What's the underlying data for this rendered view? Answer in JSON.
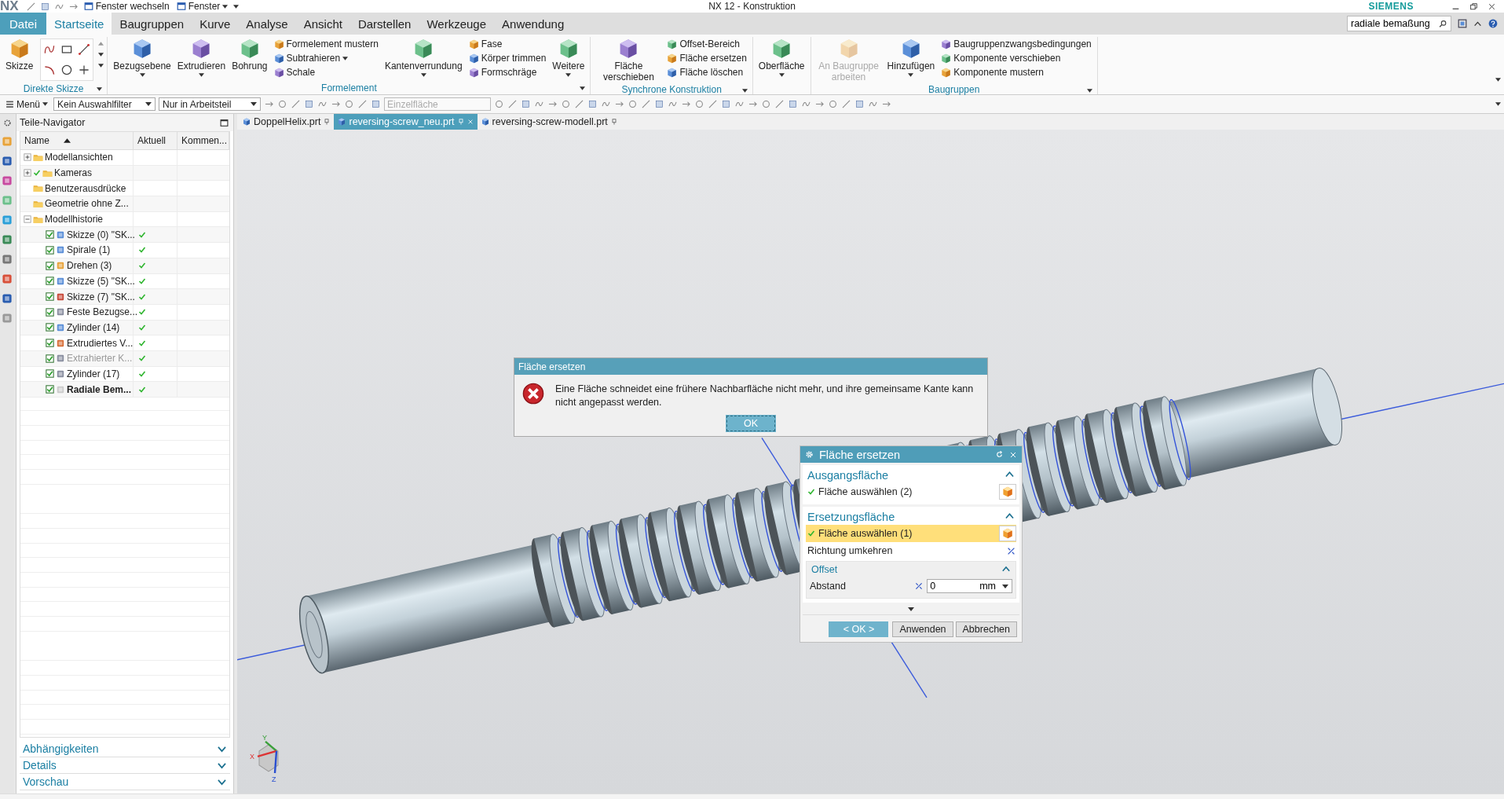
{
  "title_bar": {
    "logo": "NX",
    "quick_access": [
      {
        "label": "Fenster wechseln",
        "dropdown": false
      },
      {
        "label": "Fenster",
        "dropdown": true
      }
    ],
    "title": "NX 12 - Konstruktion",
    "brand": "SIEMENS"
  },
  "menu_tabs": [
    {
      "label": "Datei",
      "kind": "file",
      "selected": false
    },
    {
      "label": "Startseite",
      "kind": "tab",
      "selected": true
    },
    {
      "label": "Baugruppen",
      "kind": "tab",
      "selected": false
    },
    {
      "label": "Kurve",
      "kind": "tab",
      "selected": false
    },
    {
      "label": "Analyse",
      "kind": "tab",
      "selected": false
    },
    {
      "label": "Ansicht",
      "kind": "tab",
      "selected": false
    },
    {
      "label": "Darstellen",
      "kind": "tab",
      "selected": false
    },
    {
      "label": "Werkzeuge",
      "kind": "tab",
      "selected": false
    },
    {
      "label": "Anwendung",
      "kind": "tab",
      "selected": false
    }
  ],
  "search": {
    "value": "radiale bemaßung"
  },
  "ribbon": [
    {
      "title": "Direkte Skizze",
      "kind": "sketch",
      "launcher": true,
      "items": [
        {
          "label": "Skizze",
          "kind": "large",
          "dropdown": false,
          "disabled": false
        }
      ]
    },
    {
      "title": "Formelement",
      "kind": "tools",
      "launcher": true,
      "items": [
        {
          "label": "Bezugsebene",
          "kind": "large",
          "dropdown": true,
          "disabled": false
        },
        {
          "label": "Extrudieren",
          "kind": "large",
          "dropdown": true,
          "disabled": false
        },
        {
          "label": "Bohrung",
          "kind": "large",
          "dropdown": false,
          "disabled": false
        },
        {
          "label": "Formelement mustern",
          "kind": "small",
          "dropdown": false,
          "disabled": false
        },
        {
          "label": "Subtrahieren",
          "kind": "small",
          "dropdown": true,
          "disabled": false
        },
        {
          "label": "Schale",
          "kind": "small",
          "dropdown": false,
          "disabled": false
        },
        {
          "label": "Kantenverrundung",
          "kind": "large",
          "dropdown": true,
          "disabled": false
        },
        {
          "label": "Fase",
          "kind": "small",
          "dropdown": false,
          "disabled": false
        },
        {
          "label": "Körper trimmen",
          "kind": "small",
          "dropdown": false,
          "disabled": false
        },
        {
          "label": "Formschräge",
          "kind": "small",
          "dropdown": false,
          "disabled": false
        },
        {
          "label": "Weitere",
          "kind": "large",
          "dropdown": true,
          "disabled": false
        }
      ]
    },
    {
      "title": "Synchrone Konstruktion",
      "kind": "tools",
      "launcher": true,
      "items": [
        {
          "label": "Fläche verschieben",
          "kind": "large",
          "dropdown": false,
          "disabled": false
        },
        {
          "label": "Offset-Bereich",
          "kind": "small",
          "dropdown": false,
          "disabled": false
        },
        {
          "label": "Fläche ersetzen",
          "kind": "small",
          "dropdown": false,
          "disabled": false
        },
        {
          "label": "Fläche löschen",
          "kind": "small",
          "dropdown": false,
          "disabled": false
        }
      ]
    },
    {
      "kind": "tools",
      "launcher": false,
      "items": [
        {
          "label": "Oberfläche",
          "kind": "large",
          "dropdown": true,
          "disabled": false
        }
      ]
    },
    {
      "title": "Baugruppen",
      "kind": "tools",
      "launcher": true,
      "items": [
        {
          "label": "An Baugruppe arbeiten",
          "kind": "large",
          "dropdown": false,
          "disabled": true
        },
        {
          "label": "Hinzufügen",
          "kind": "large",
          "dropdown": true,
          "disabled": false
        },
        {
          "label": "Baugruppenzwangsbedingungen",
          "kind": "small",
          "dropdown": false,
          "disabled": false
        },
        {
          "label": "Komponente verschieben",
          "kind": "small",
          "dropdown": false,
          "disabled": false
        },
        {
          "label": "Komponente mustern",
          "kind": "small",
          "dropdown": false,
          "disabled": false
        }
      ]
    }
  ],
  "toolbar": {
    "menu": "Menü",
    "filters": [
      "Kein Auswahlfilter",
      "Nur in Arbeitsteil"
    ],
    "selection_field": {
      "placeholder": "Einzelfläche"
    }
  },
  "navigator": {
    "title": "Teile-Navigator",
    "columns": [
      "Name",
      "Aktuell",
      "Kommen..."
    ],
    "tree": [
      {
        "label": "Modellansichten",
        "expanded": false,
        "checked": false
      },
      {
        "label": "Kameras",
        "expanded": false,
        "checked": true
      },
      {
        "label": "Benutzerausdrücke",
        "checked": false
      },
      {
        "label": "Geometrie ohne Z...",
        "checked": false
      },
      {
        "label": "Modellhistorie",
        "expanded": true,
        "checked": false,
        "children": [
          {
            "label": "Skizze (0) \"SK...",
            "checked": true,
            "current": true,
            "dimmed": false,
            "active": false
          },
          {
            "label": "Spirale (1)",
            "checked": true,
            "current": true,
            "dimmed": false,
            "active": false
          },
          {
            "label": "Drehen (3)",
            "checked": true,
            "current": true,
            "dimmed": false,
            "active": false
          },
          {
            "label": "Skizze (5) \"SK...",
            "checked": true,
            "current": true,
            "dimmed": false,
            "active": false
          },
          {
            "label": "Skizze (7) \"SK...",
            "checked": true,
            "current": true,
            "dimmed": false,
            "active": false
          },
          {
            "label": "Feste Bezugse...",
            "checked": true,
            "current": true,
            "dimmed": false,
            "active": false
          },
          {
            "label": "Zylinder (14)",
            "checked": true,
            "current": true,
            "dimmed": false,
            "active": false
          },
          {
            "label": "Extrudiertes V...",
            "checked": true,
            "current": true,
            "dimmed": false,
            "active": false
          },
          {
            "label": "Extrahierter K...",
            "checked": true,
            "current": true,
            "dimmed": true,
            "active": false
          },
          {
            "label": "Zylinder (17)",
            "checked": true,
            "current": true,
            "dimmed": false,
            "active": false
          },
          {
            "label": "Radiale Bem...",
            "checked": true,
            "current": true,
            "dimmed": false,
            "active": true
          }
        ]
      }
    ],
    "panels": [
      {
        "label": "Abhängigkeiten",
        "expanded": false
      },
      {
        "label": "Details",
        "expanded": false
      },
      {
        "label": "Vorschau",
        "expanded": false
      }
    ]
  },
  "doc_tabs": [
    {
      "label": "DoppelHelix.prt",
      "selected": false
    },
    {
      "label": "reversing-screw_neu.prt",
      "selected": true
    },
    {
      "label": "reversing-screw-modell.prt",
      "selected": false
    }
  ],
  "viewport": {
    "triad": [
      "X",
      "Y",
      "Z"
    ]
  },
  "error_dialog": {
    "title": "Fläche ersetzen",
    "message": "Eine Fläche schneidet eine frühere Nachbarfläche nicht mehr, und ihre gemeinsame Kante kann nicht angepasst werden.",
    "button": "OK"
  },
  "replace_dialog": {
    "title": "Fläche ersetzen",
    "sections": [
      {
        "title": "Ausgangsfläche",
        "expanded": true,
        "rows": [
          {
            "kind": "select",
            "label": "Fläche auswählen (2)",
            "done": true,
            "selected": false
          }
        ]
      },
      {
        "title": "Ersetzungsfläche",
        "expanded": true,
        "rows": [
          {
            "kind": "select",
            "label": "Fläche auswählen (1)",
            "done": true,
            "selected": true
          },
          {
            "kind": "toggle",
            "label": "Richtung umkehren"
          }
        ],
        "subsection": {
          "title": "Offset",
          "expanded": true,
          "field": {
            "label": "Abstand",
            "value": "0",
            "unit": "mm"
          }
        }
      }
    ],
    "buttons": [
      {
        "label": "< OK >",
        "kind": "primary"
      },
      {
        "label": "Anwenden",
        "kind": "normal"
      },
      {
        "label": "Abbrechen",
        "kind": "normal"
      }
    ]
  }
}
